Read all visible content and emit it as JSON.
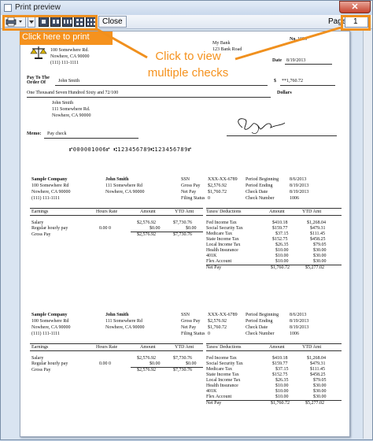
{
  "window": {
    "title": "Print preview",
    "close_glyph": "✕"
  },
  "toolbar": {
    "close_label": "Close",
    "page_label": "Page",
    "page_value": "1",
    "print_icon": "printer-icon"
  },
  "annotations": {
    "print_hint": "Click here to print",
    "multi_hint_line1": "Click to view",
    "multi_hint_line2": "multiple checks"
  },
  "check": {
    "company_address1": "100 Somewhere Rd.",
    "company_address2": "Nowhere, CA 90000",
    "company_phone": "(111) 111-1111",
    "bank_name": "My Bank",
    "bank_address": "123 Bank Road",
    "no_label": "No.",
    "no_value": "1006",
    "date_label": "Date",
    "date_value": "8/19/2013",
    "pay_to_label1": "Pay To The",
    "pay_to_label2": "Order Of",
    "payee": "John Smith",
    "dollar_sign": "$",
    "amount": "**1,760.72",
    "amount_words": "One Thousand Seven Hundred Sixty and 72/100",
    "dollars_label": "Dollars",
    "payee_address1": "John Smith",
    "payee_address2": "111 Somewhere Rd.",
    "payee_address3": "Nowhere, CA 90000",
    "memo_label": "Memo:",
    "memo_value": "Pay check",
    "micr": "⑈000001006⑈ ⑆123456789⑆123456789⑈"
  },
  "stub": {
    "company": "Sample Company",
    "company_addr1": "100 Somewhere Rd",
    "company_addr2": "Nowhere, CA 90000",
    "company_phone": "(111) 111-1111",
    "employee": "John Smith",
    "emp_addr1": "111 Somewhere Rd",
    "emp_addr2": "Nowhere, CA 90000",
    "ssn_label": "SSN",
    "ssn": "XXX-XX-6789",
    "gross_label": "Gross Pay",
    "gross": "$2,576.92",
    "net_label": "Net Pay",
    "net": "$1,760.72",
    "filing_label": "Filing Status",
    "filing": "0",
    "pb_label": "Period Beginning",
    "pb": "8/6/2013",
    "pe_label": "Period Ending",
    "pe": "8/19/2013",
    "cd_label": "Check Date",
    "cd": "8/19/2013",
    "cn_label": "Check Number",
    "cn": "1006",
    "earn_headers": [
      "Earnings",
      "Hours Rate",
      "Amount",
      "YTD Amt"
    ],
    "earnings": [
      {
        "name": "Salary",
        "hours": "",
        "amount": "$2,576.92",
        "ytd": "$7,730.76"
      },
      {
        "name": "Regular hourly pay",
        "hours": "0.00 0",
        "amount": "$0.00",
        "ytd": "$0.00"
      },
      {
        "name": "Gross Pay",
        "hours": "",
        "amount": "$2,576.92",
        "ytd": "$7,730.76"
      }
    ],
    "tax_headers": [
      "Taxes/ Deductions",
      "Amount",
      "YTD Amt"
    ],
    "taxes": [
      {
        "name": "Fed Income Tax",
        "amount": "$410.18",
        "ytd": "$1,268.04"
      },
      {
        "name": "Social Security Tax",
        "amount": "$159.77",
        "ytd": "$479.31"
      },
      {
        "name": "Medicare Tax",
        "amount": "$37.15",
        "ytd": "$111.45"
      },
      {
        "name": "State Income Tax",
        "amount": "$152.75",
        "ytd": "$458.25"
      },
      {
        "name": "Local Income Tax",
        "amount": "$26.35",
        "ytd": "$79.05"
      },
      {
        "name": "Health Insurance",
        "amount": "$10.00",
        "ytd": "$30.00"
      },
      {
        "name": "401K",
        "amount": "$10.00",
        "ytd": "$30.00"
      },
      {
        "name": "Flex Account",
        "amount": "$10.00",
        "ytd": "$30.00"
      },
      {
        "name": "Net Pay",
        "amount": "$1,760.72",
        "ytd": "$5,277.02"
      }
    ]
  },
  "colors": {
    "accent": "#f5921e"
  }
}
